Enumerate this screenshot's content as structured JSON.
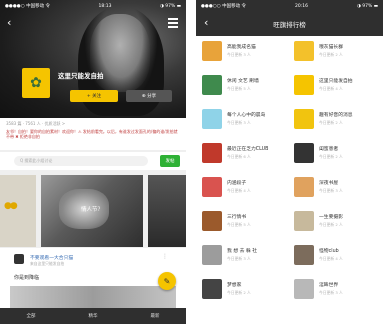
{
  "left": {
    "status": {
      "signal": "●●●●○ 中国移动 令",
      "time": "18:13",
      "battery": "◑ 97% ▬"
    },
    "group_name": "这里只能发自拍",
    "join_label": "+ 关注",
    "share_label": "⊕ 分享",
    "stats": "3583 篇 · 7561 人 · 优质活跃 >",
    "description": "友邻！自拍！要你的自拍素材！欢迎你！⚠ 发帖前看完。以后，有谁发过发面孔的/偏的谁/发拍就不带 ✖ 拒绝非自拍",
    "search_placeholder": "Q 搜索此小组讨论",
    "search_label": "发帖",
    "card_caption": "情人节？",
    "post_title": "不要观看一大合只猫",
    "post_meta": "来自这里只能发自拍",
    "post_body": "你是到降临",
    "tabs": [
      "全部",
      "精华",
      "最新"
    ]
  },
  "right": {
    "status": {
      "signal": "●●●○○ 中国移动 令",
      "time": "20:16",
      "battery": "◑ 97% ▬"
    },
    "title": "旺旗排行榜",
    "groups": [
      {
        "name": "高能我成名猫",
        "meta": "今日更新 3 人",
        "color": "#e8a33a"
      },
      {
        "name": "哦灰猫长群",
        "meta": "今日更新 2 人",
        "color": "#f3c12b"
      },
      {
        "name": "休闲 文艺 刷墙",
        "meta": "今日更新 5 人",
        "color": "#3f8a4d"
      },
      {
        "name": "这里只能发自拍",
        "meta": "今日更新 4 人",
        "color": "#f5c400"
      },
      {
        "name": "每个人心中的晨岛",
        "meta": "今日更新 3 人",
        "color": "#8fd3e8"
      },
      {
        "name": "趣有好音的消息",
        "meta": "今日更新 2 人",
        "color": "#f1c40f"
      },
      {
        "name": "最近正在乏力CLUB",
        "meta": "今日更新 6 人",
        "color": "#c0392b"
      },
      {
        "name": "闺蜜患者",
        "meta": "今日更新 2 人",
        "color": "#333333"
      },
      {
        "name": "内涵段子",
        "meta": "今日更新 4 人",
        "color": "#d9534f"
      },
      {
        "name": "深夜书屋",
        "meta": "今日更新 3 人",
        "color": "#e0a25e"
      },
      {
        "name": "三行情书",
        "meta": "今日更新 5 人",
        "color": "#9b5a2c"
      },
      {
        "name": "一生要摄影",
        "meta": "今日更新 2 人",
        "color": "#c7b99c"
      },
      {
        "name": "我 想 去 躲 社",
        "meta": "今日更新 3 人",
        "color": "#9c9c9c"
      },
      {
        "name": "怪物club",
        "meta": "今日更新 4 人",
        "color": "#7c6c5c"
      },
      {
        "name": "梦想家",
        "meta": "今日更新 2 人",
        "color": "#444444"
      },
      {
        "name": "淫眸世界",
        "meta": "今日更新 3 人",
        "color": "#b8b8b8"
      }
    ]
  }
}
